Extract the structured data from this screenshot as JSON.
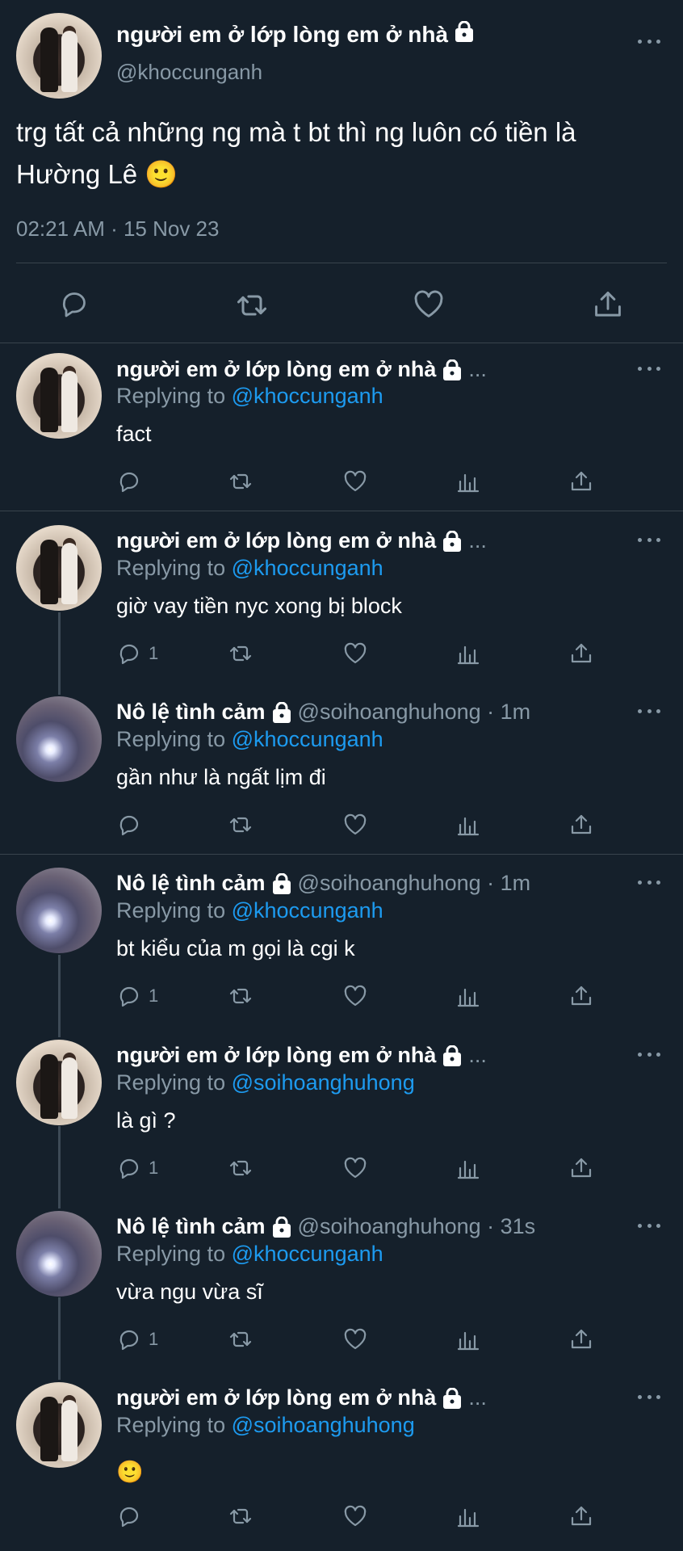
{
  "main_tweet": {
    "name": "người em ở lớp lòng em ở nhà",
    "handle": "@khoccunganh",
    "text": "trg tất cả những ng mà t bt thì ng luôn có tiền là Hường Lê 🙂",
    "timestamp": "02:21 AM · 15 Nov 23"
  },
  "replies": [
    {
      "name": "người em ở lớp lòng em ở nhà",
      "meta": "...",
      "replying_label": "Replying to",
      "replying_handle": "@khoccunganh",
      "text": "fact",
      "reply_count": ""
    },
    {
      "name": "người em ở lớp lòng em ở nhà",
      "meta": "...",
      "replying_label": "Replying to",
      "replying_handle": "@khoccunganh",
      "text": "giờ vay tiền nyc xong bị block",
      "reply_count": "1"
    },
    {
      "name": "Nô lệ tình cảm",
      "meta": "@soihoanghuhong · 1m",
      "replying_label": "Replying to",
      "replying_handle": "@khoccunganh",
      "text": "gần như là ngất lịm đi",
      "reply_count": ""
    },
    {
      "name": "Nô lệ tình cảm",
      "meta": "@soihoanghuhong · 1m",
      "replying_label": "Replying to",
      "replying_handle": "@khoccunganh",
      "text": "bt kiểu của m gọi là cgi k",
      "reply_count": "1"
    },
    {
      "name": "người em ở lớp lòng em ở nhà",
      "meta": "...",
      "replying_label": "Replying to",
      "replying_handle": "@soihoanghuhong",
      "text": "là gì ?",
      "reply_count": "1"
    },
    {
      "name": "Nô lệ tình cảm",
      "meta": "@soihoanghuhong · 31s",
      "replying_label": "Replying to",
      "replying_handle": "@khoccunganh",
      "text": "vừa ngu vừa sĩ",
      "reply_count": "1"
    },
    {
      "name": "người em ở lớp lòng em ở nhà",
      "meta": "...",
      "replying_label": "Replying to",
      "replying_handle": "@soihoanghuhong",
      "text": "🙂",
      "reply_count": ""
    }
  ],
  "icons": {
    "reply": "reply-icon",
    "retweet": "retweet-icon",
    "like": "heart-icon",
    "views": "views-icon",
    "share": "share-icon",
    "more": "more-icon",
    "lock": "lock-icon"
  },
  "colors": {
    "background": "#15202b",
    "text": "#ffffff",
    "secondary": "#8899a6",
    "link": "#1d9bf0",
    "divider": "#38444d"
  }
}
